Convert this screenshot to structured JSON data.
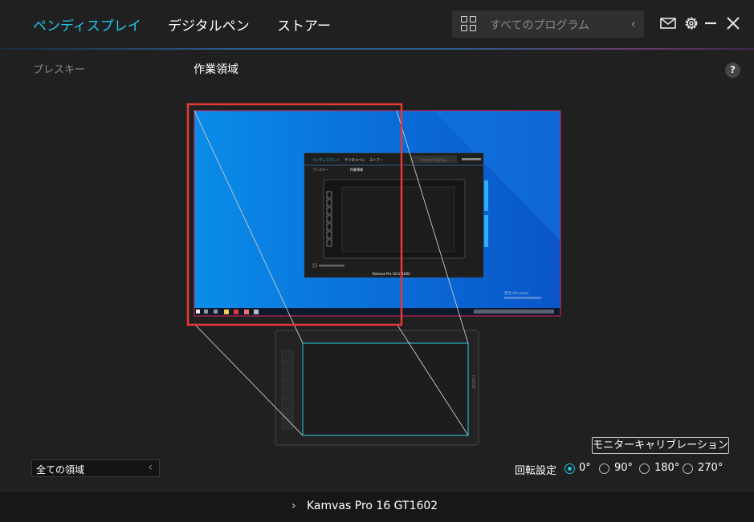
{
  "nav": {
    "tabs": [
      {
        "label": "ペンディスプレイ",
        "active": true
      },
      {
        "label": "デジタルペン",
        "active": false
      },
      {
        "label": "ストアー",
        "active": false
      }
    ]
  },
  "search": {
    "placeholder": "すべてのプログラム"
  },
  "header_icons": [
    "grid-icon",
    "mail-icon",
    "gear-icon",
    "minimize-icon",
    "close-icon"
  ],
  "sidebar": {
    "label": "プレスキー"
  },
  "main": {
    "title": "作業領域",
    "help": "?"
  },
  "area_select": {
    "value": "全ての領域"
  },
  "calibration": {
    "label": "モニターキャリブレーション"
  },
  "rotation": {
    "label": "回転設定",
    "options": [
      {
        "label": "0°",
        "selected": true
      },
      {
        "label": "90°",
        "selected": false
      },
      {
        "label": "180°",
        "selected": false
      },
      {
        "label": "270°",
        "selected": false
      }
    ]
  },
  "footer": {
    "device": "Kamvas Pro 16 GT1602"
  },
  "preview": {
    "mini_tabs": [
      "ペンディスプレイ",
      "デジタルペン",
      "ストアー"
    ],
    "mini_search": "すべてのプログラム",
    "mini_side": "プレスキー",
    "mini_title": "作業領域",
    "mini_device": "Kamvas Pro 16 GT1602",
    "windows_activate": "激活 Windows",
    "tablet_brand": "HUION"
  },
  "colors": {
    "accent": "#21c6e6",
    "selection_red": "#e53935",
    "background": "#202020"
  }
}
